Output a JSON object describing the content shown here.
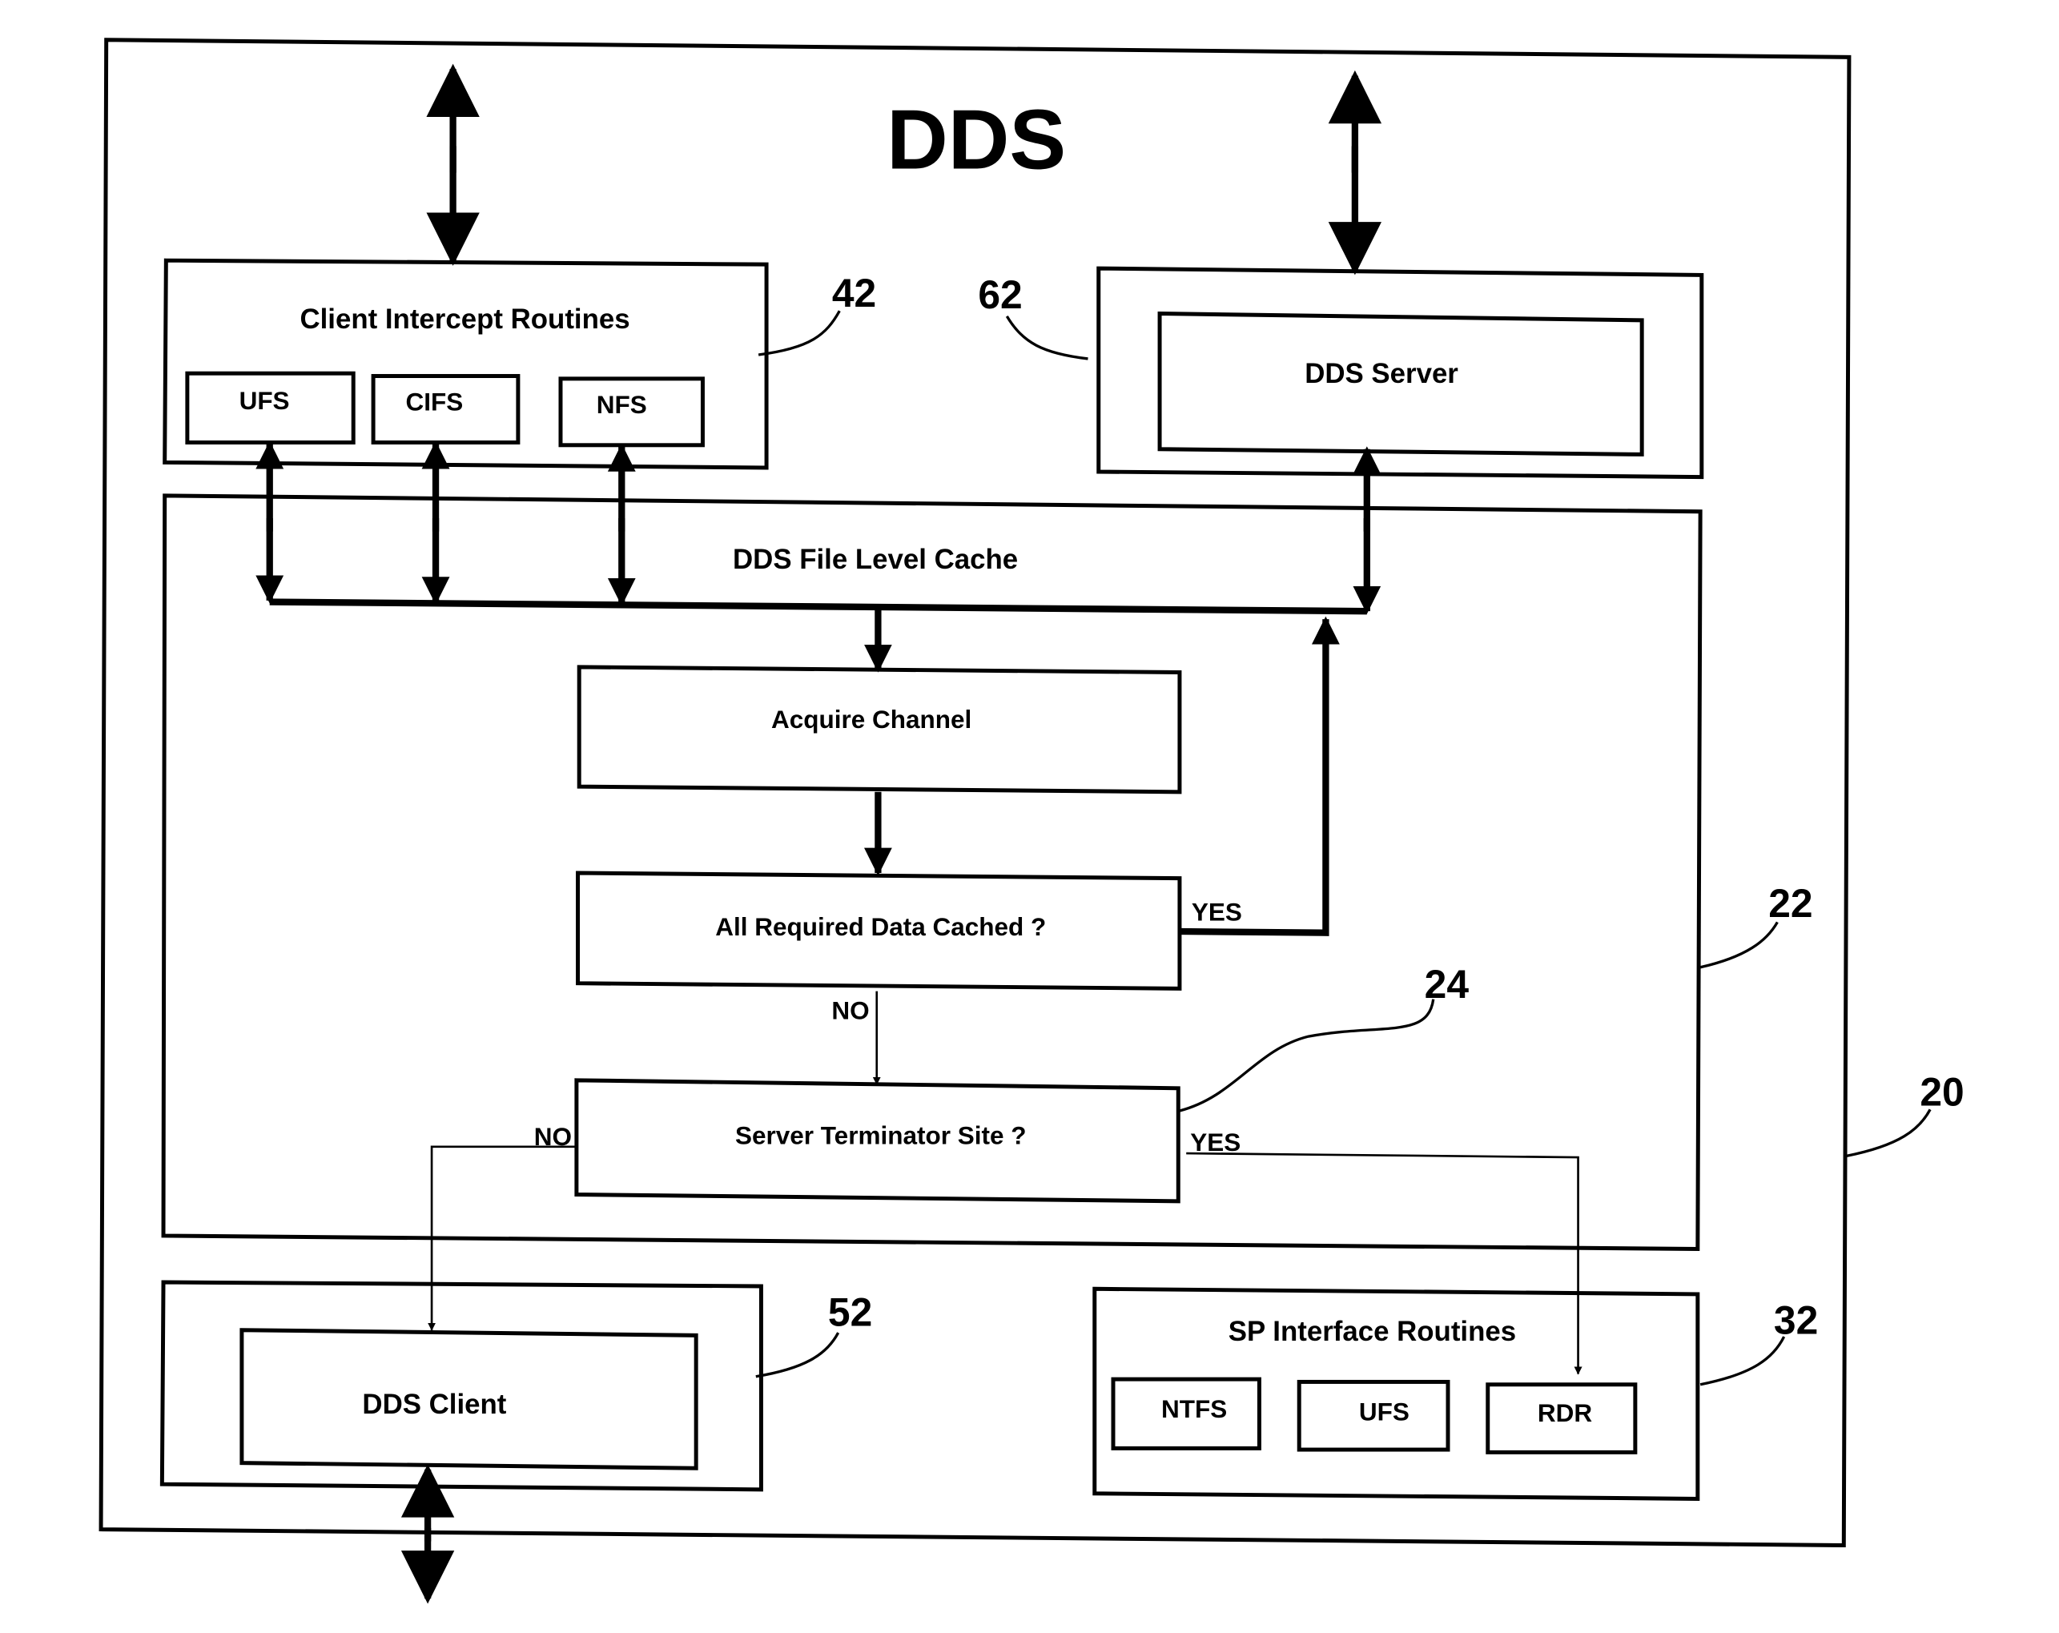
{
  "diagram": {
    "title": "DDS",
    "outer_ref": "20",
    "client_intercept": {
      "label": "Client Intercept Routines",
      "ref": "42",
      "items": [
        "UFS",
        "CIFS",
        "NFS"
      ]
    },
    "dds_server": {
      "label": "DDS Server",
      "ref": "62"
    },
    "file_level_cache": {
      "label": "DDS File Level Cache",
      "ref": "22"
    },
    "acquire_channel": {
      "label": "Acquire Channel"
    },
    "all_cached": {
      "label": "All Required Data Cached ?",
      "yes": "YES",
      "no": "NO"
    },
    "server_terminator": {
      "label": "Server Terminator Site ?",
      "ref": "24",
      "yes": "YES",
      "no": "NO"
    },
    "dds_client": {
      "label": "DDS Client",
      "ref": "52"
    },
    "sp_interface": {
      "label": "SP Interface Routines",
      "ref": "32",
      "items": [
        "NTFS",
        "UFS",
        "RDR"
      ]
    }
  }
}
